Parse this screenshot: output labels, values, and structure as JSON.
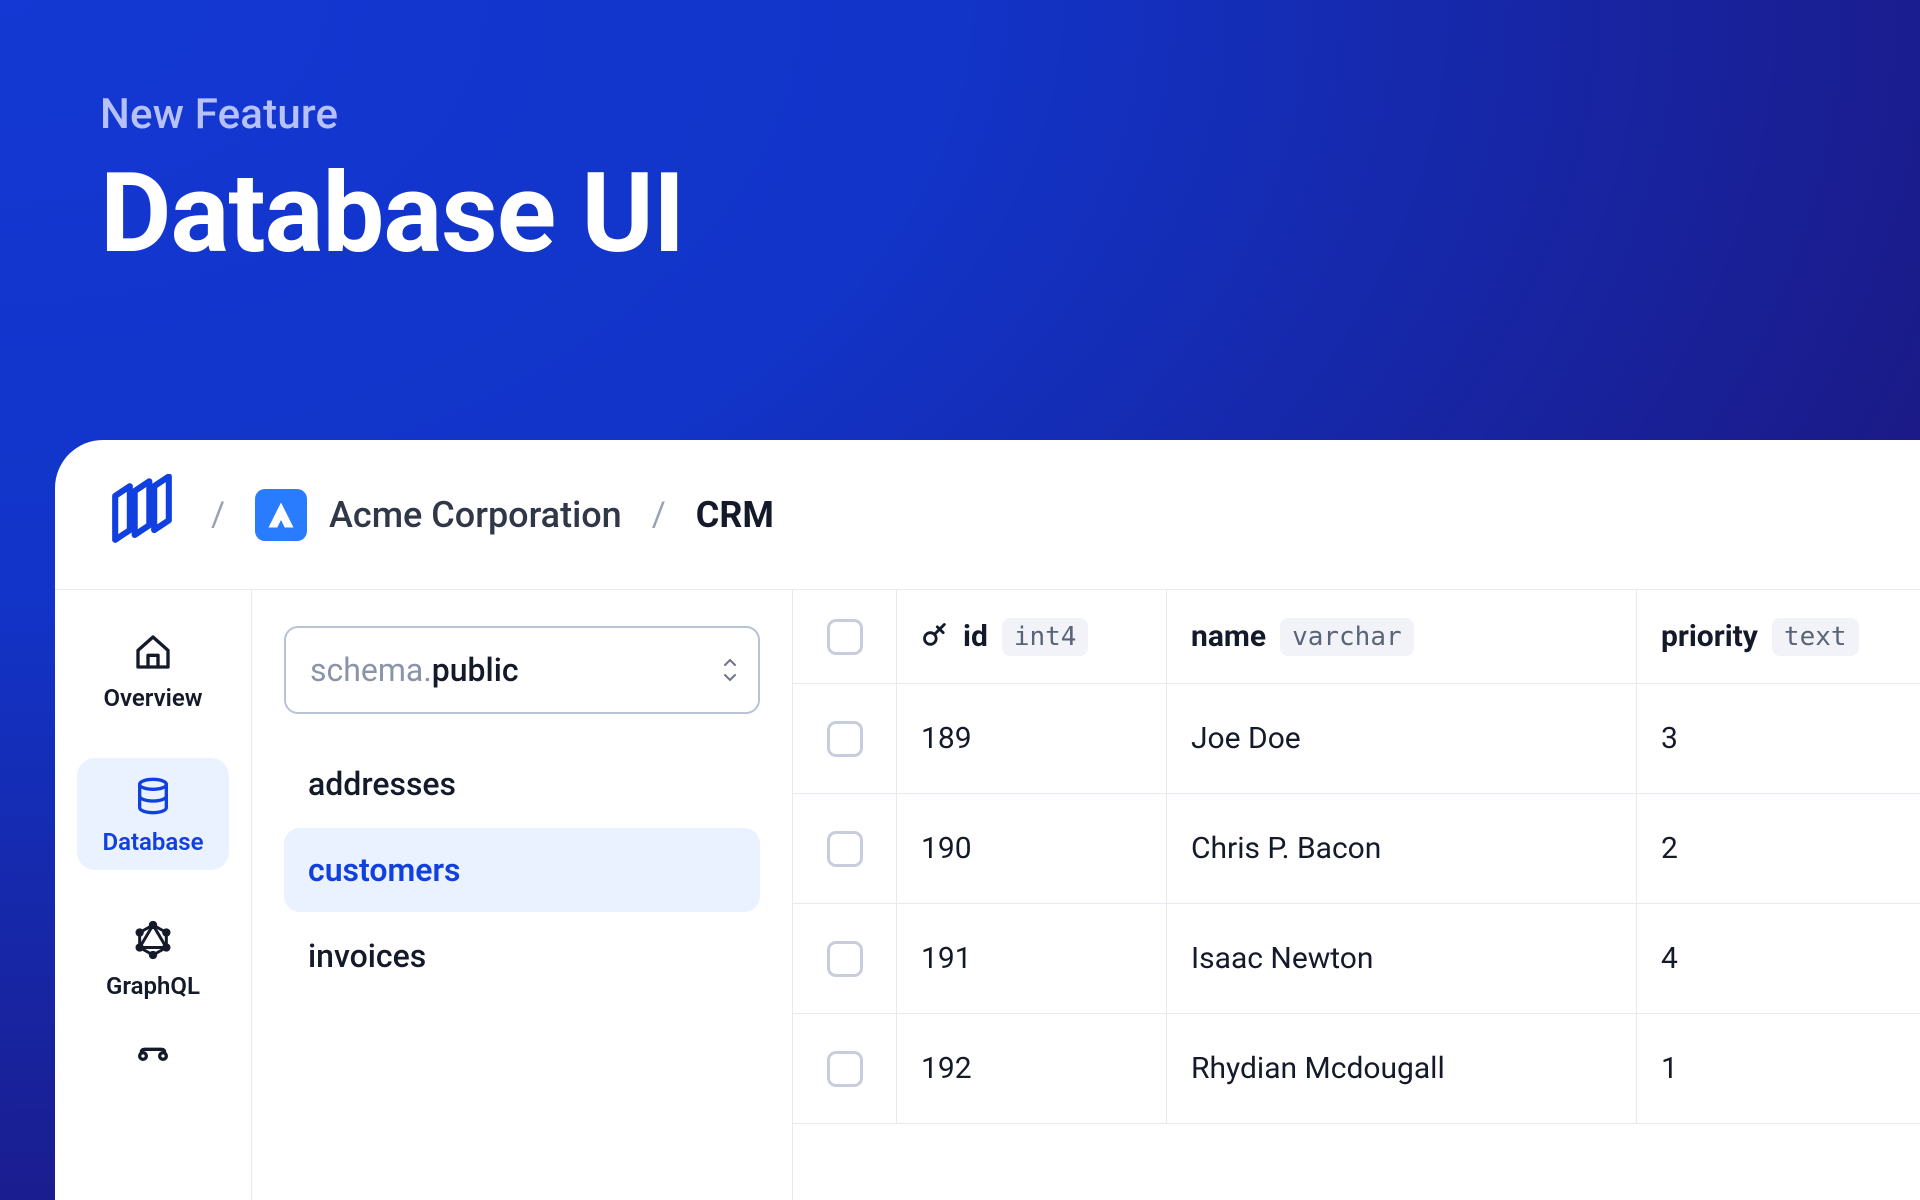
{
  "hero": {
    "kicker": "New Feature",
    "title": "Database UI"
  },
  "breadcrumb": {
    "org": "Acme Corporation",
    "project": "CRM"
  },
  "nav": {
    "overview": "Overview",
    "database": "Database",
    "graphql": "GraphQL"
  },
  "schema": {
    "prefix": "schema.",
    "value": "public"
  },
  "tables": {
    "0": "addresses",
    "1": "customers",
    "2": "invoices"
  },
  "columns": {
    "id": {
      "name": "id",
      "type": "int4"
    },
    "name": {
      "name": "name",
      "type": "varchar"
    },
    "priority": {
      "name": "priority",
      "type": "text"
    }
  },
  "rows": {
    "0": {
      "id": "189",
      "name": "Joe Doe",
      "priority": "3"
    },
    "1": {
      "id": "190",
      "name": "Chris P. Bacon",
      "priority": "2"
    },
    "2": {
      "id": "191",
      "name": "Isaac Newton",
      "priority": "4"
    },
    "3": {
      "id": "192",
      "name": "Rhydian Mcdougall",
      "priority": "1"
    }
  }
}
